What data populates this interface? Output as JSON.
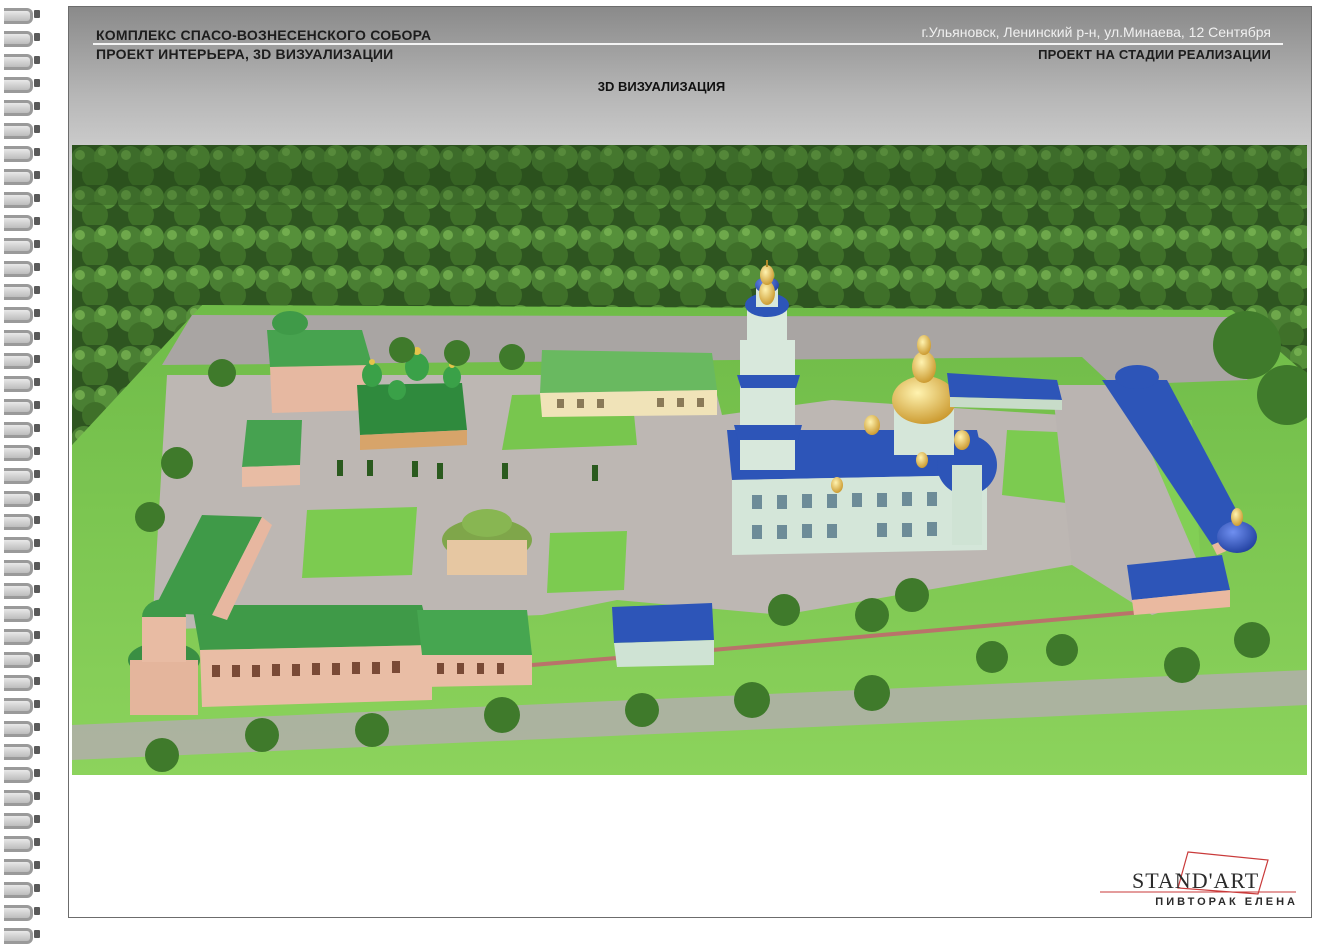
{
  "header": {
    "title_line1": "КОМПЛЕКС СПАСО-ВОЗНЕСЕНСКОГО СОБОРА",
    "title_line2": "ПРОЕКТ ИНТЕРЬЕРА, 3D ВИЗУАЛИЗАЦИИ",
    "address": "г.Ульяновск, Ленинский р-н, ул.Минаева, 12 Сентября",
    "status": "ПРОЕКТ НА СТАДИИ РЕАЛИЗАЦИИ"
  },
  "section_title": "3D ВИЗУАЛИЗАЦИЯ",
  "logo": {
    "brand": "STAND'ART",
    "author": "ПИВТОРАК ЕЛЕНА"
  },
  "colors": {
    "forest": "#3f6e2a",
    "lawn": "#7cc552",
    "paving": "#b9b3b0",
    "roof_blue": "#2d55b8",
    "roof_green": "#3f9a48",
    "dome_gold": "#d9b23a",
    "walls_pink": "#e6b9a1",
    "walls_mint": "#cfe3d4"
  },
  "icons": [
    "spiral-binding-icon",
    "logo-frame-icon"
  ]
}
